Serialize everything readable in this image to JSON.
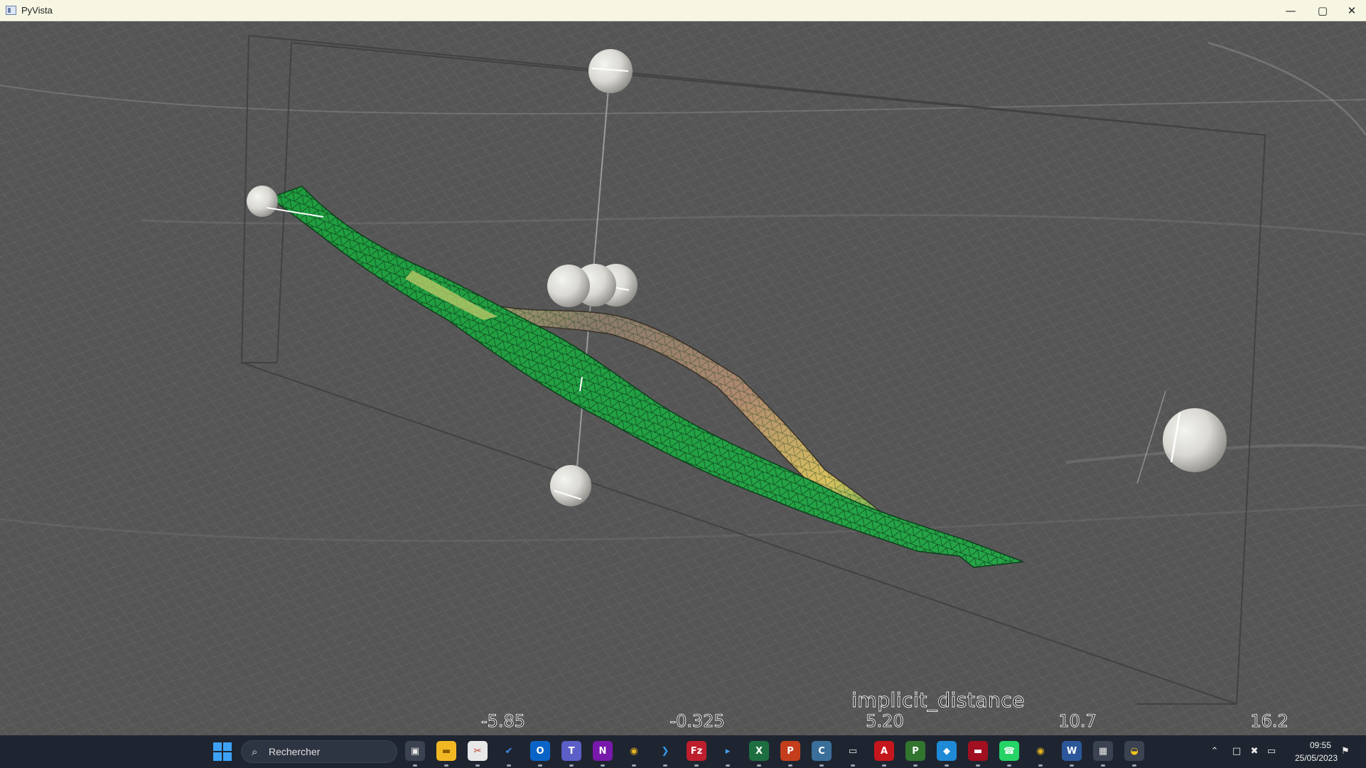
{
  "window": {
    "title": "PyVista",
    "minimize_glyph": "—",
    "maximize_glyph": "▢",
    "close_glyph": "✕"
  },
  "viewport": {
    "background": "#555555",
    "mesh_colors": [
      "#1f9d3f",
      "#2cb050",
      "#8fb85a",
      "#a08070",
      "#c9b25a"
    ]
  },
  "scalar_bar": {
    "title": "implicit_distance",
    "ticks": [
      "-5.85",
      "-0.325",
      "5.20",
      "10.7",
      "16.2"
    ]
  },
  "taskbar": {
    "search_placeholder": "Rechercher",
    "apps": [
      {
        "name": "task-view",
        "glyph": "▣",
        "bg": "#3b4250",
        "fg": "#e8e8e8"
      },
      {
        "name": "file-explorer",
        "glyph": "▬",
        "bg": "#f2b824",
        "fg": "#8a5b00"
      },
      {
        "name": "snipping-tool",
        "glyph": "✂",
        "bg": "#e8e8e8",
        "fg": "#c0392b"
      },
      {
        "name": "todo",
        "glyph": "✔",
        "bg": "#1f2530",
        "fg": "#3c8cf0"
      },
      {
        "name": "outlook",
        "glyph": "O",
        "bg": "#0a64c8",
        "fg": "#ffffff"
      },
      {
        "name": "teams",
        "glyph": "T",
        "bg": "#5b5fc7",
        "fg": "#ffffff"
      },
      {
        "name": "onenote",
        "glyph": "N",
        "bg": "#7719aa",
        "fg": "#ffffff"
      },
      {
        "name": "chrome",
        "glyph": "◉",
        "bg": "#1f2530",
        "fg": "#e6b422"
      },
      {
        "name": "vscode",
        "glyph": "❯",
        "bg": "#1f2530",
        "fg": "#2f9cf0"
      },
      {
        "name": "filezilla",
        "glyph": "Fz",
        "bg": "#bf1e2d",
        "fg": "#ffffff"
      },
      {
        "name": "terminal",
        "glyph": "▸",
        "bg": "#1f2530",
        "fg": "#4aa0f0"
      },
      {
        "name": "excel",
        "glyph": "X",
        "bg": "#1d6f42",
        "fg": "#ffffff"
      },
      {
        "name": "powerpoint",
        "glyph": "P",
        "bg": "#c43e1c",
        "fg": "#ffffff"
      },
      {
        "name": "cloudcompare",
        "glyph": "C",
        "bg": "#3a6f9a",
        "fg": "#ffffff"
      },
      {
        "name": "remote-desktop",
        "glyph": "▭",
        "bg": "#1f2530",
        "fg": "#e8e8e8"
      },
      {
        "name": "acrobat",
        "glyph": "A",
        "bg": "#c4161c",
        "fg": "#ffffff"
      },
      {
        "name": "project",
        "glyph": "P",
        "bg": "#31752f",
        "fg": "#ffffff"
      },
      {
        "name": "docker",
        "glyph": "◆",
        "bg": "#1f8ad6",
        "fg": "#ffffff"
      },
      {
        "name": "red-app",
        "glyph": "▬",
        "bg": "#a01020",
        "fg": "#ffffff"
      },
      {
        "name": "whatsapp",
        "glyph": "☎",
        "bg": "#25d366",
        "fg": "#ffffff"
      },
      {
        "name": "chrome-profile",
        "glyph": "◉",
        "bg": "#1f2530",
        "fg": "#e6b422"
      },
      {
        "name": "word",
        "glyph": "W",
        "bg": "#2b579a",
        "fg": "#ffffff"
      },
      {
        "name": "calculator",
        "glyph": "▦",
        "bg": "#3b4250",
        "fg": "#e8e8e8"
      },
      {
        "name": "python",
        "glyph": "◒",
        "bg": "#3b4250",
        "fg": "#f5c518"
      }
    ],
    "tray": {
      "chevron": "⌃",
      "network": "□",
      "volume": "✖",
      "battery": "▭",
      "time": "09:55",
      "date": "25/05/2023",
      "notification": "⚑"
    }
  }
}
